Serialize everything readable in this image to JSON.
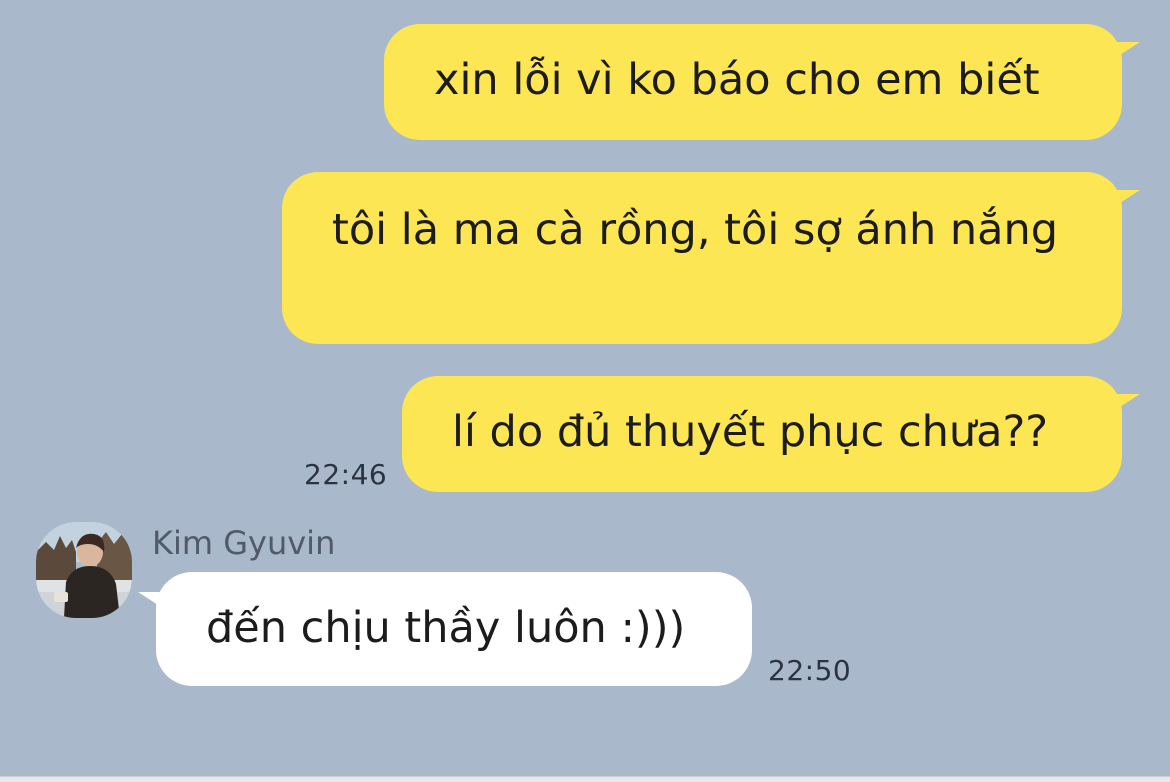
{
  "messages": [
    {
      "direction": "sent",
      "text": "xin lỗi vì ko báo cho em biết"
    },
    {
      "direction": "sent",
      "text": "tôi là ma cà rồng, tôi sợ ánh nắng"
    },
    {
      "direction": "sent",
      "text": "lí do đủ thuyết phục chưa??",
      "time": "22:46"
    },
    {
      "direction": "received",
      "sender": "Kim Gyuvin",
      "text": "đến chịu thầy luôn :)))",
      "time": "22:50"
    }
  ],
  "colors": {
    "background": "#a9b8cb",
    "sent_bubble": "#fce653",
    "received_bubble": "#ffffff"
  },
  "icons": {
    "avatar": "profile-photo"
  }
}
